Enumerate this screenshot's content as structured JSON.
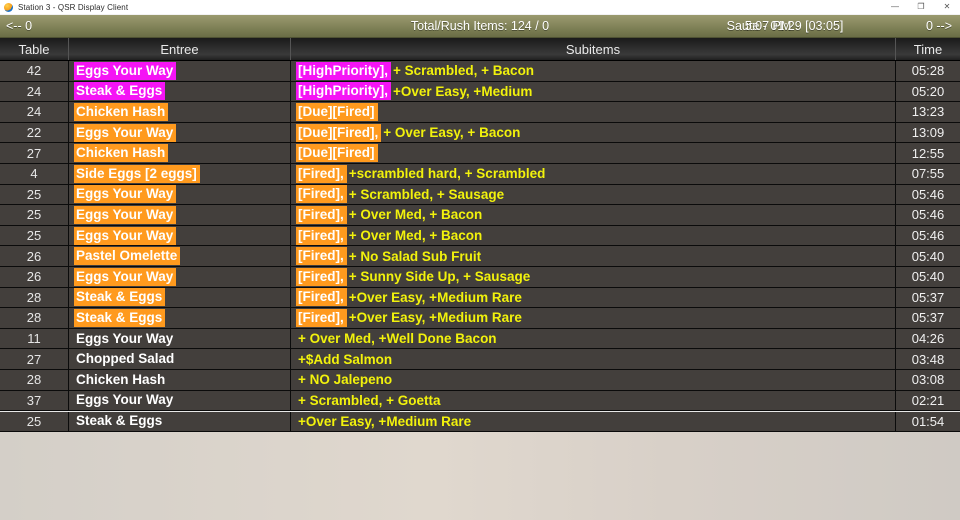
{
  "window": {
    "title": "Station 3 - QSR Display Client",
    "icon": "app-globe-icon",
    "controls": {
      "minimize": "—",
      "maximize": "❐",
      "close": "✕"
    }
  },
  "statusbar": {
    "left_nav": "<-- 0",
    "total_label": "Total/Rush Items: 124 / 0",
    "station": "Saute  - 01:29   [03:05]",
    "clock": "5:07 PM",
    "right_nav": "0 -->"
  },
  "colors": {
    "status_bar": "#8d8d63",
    "row_bg": "#43403d",
    "header_bg": "#2e2e2e",
    "high_priority": "#f514f5",
    "fired": "#ff9a1e",
    "subitem_text": "#f2f20c",
    "entree_text": "#ffffff"
  },
  "table": {
    "columns": [
      "Table",
      "Entree",
      "Subitems",
      "Time"
    ],
    "rows": [
      {
        "table": "42",
        "entree": "Eggs Your Way",
        "entree_hl": "magenta",
        "tag": "[HighPriority],",
        "tag_hl": "magenta",
        "subitems": "+ Scrambled, + Bacon",
        "time": "05:28"
      },
      {
        "table": "24",
        "entree": "Steak & Eggs",
        "entree_hl": "magenta",
        "tag": "[HighPriority],",
        "tag_hl": "magenta",
        "subitems": "+Over Easy, +Medium",
        "time": "05:20"
      },
      {
        "table": "24",
        "entree": "Chicken Hash",
        "entree_hl": "orange",
        "tag": "[Due][Fired]",
        "tag_hl": "orange",
        "subitems": "",
        "time": "13:23"
      },
      {
        "table": "22",
        "entree": "Eggs Your Way",
        "entree_hl": "orange",
        "tag": "[Due][Fired],",
        "tag_hl": "orange",
        "subitems": "+ Over Easy, + Bacon",
        "time": "13:09"
      },
      {
        "table": "27",
        "entree": "Chicken Hash",
        "entree_hl": "orange",
        "tag": "[Due][Fired]",
        "tag_hl": "orange",
        "subitems": "",
        "time": "12:55"
      },
      {
        "table": "4",
        "entree": "Side Eggs [2 eggs]",
        "entree_hl": "orange",
        "tag": "[Fired],",
        "tag_hl": "orange",
        "subitems": "+scrambled hard, + Scrambled",
        "time": "07:55"
      },
      {
        "table": "25",
        "entree": "Eggs Your Way",
        "entree_hl": "orange",
        "tag": "[Fired],",
        "tag_hl": "orange",
        "subitems": "+ Scrambled, + Sausage",
        "time": "05:46"
      },
      {
        "table": "25",
        "entree": "Eggs Your Way",
        "entree_hl": "orange",
        "tag": "[Fired],",
        "tag_hl": "orange",
        "subitems": "+ Over Med, + Bacon",
        "time": "05:46"
      },
      {
        "table": "25",
        "entree": "Eggs Your Way",
        "entree_hl": "orange",
        "tag": "[Fired],",
        "tag_hl": "orange",
        "subitems": "+ Over Med, + Bacon",
        "time": "05:46"
      },
      {
        "table": "26",
        "entree": "Pastel Omelette",
        "entree_hl": "orange",
        "tag": "[Fired],",
        "tag_hl": "orange",
        "subitems": "+ No Salad Sub Fruit",
        "time": "05:40"
      },
      {
        "table": "26",
        "entree": "Eggs Your Way",
        "entree_hl": "orange",
        "tag": "[Fired],",
        "tag_hl": "orange",
        "subitems": "+ Sunny Side Up, + Sausage",
        "time": "05:40"
      },
      {
        "table": "28",
        "entree": "Steak & Eggs",
        "entree_hl": "orange",
        "tag": "[Fired],",
        "tag_hl": "orange",
        "subitems": "+Over Easy, +Medium Rare",
        "time": "05:37"
      },
      {
        "table": "28",
        "entree": "Steak & Eggs",
        "entree_hl": "orange",
        "tag": "[Fired],",
        "tag_hl": "orange",
        "subitems": "+Over Easy, +Medium Rare",
        "time": "05:37"
      },
      {
        "table": "11",
        "entree": "Eggs Your Way",
        "entree_hl": "none",
        "tag": "",
        "tag_hl": "none",
        "subitems": "+ Over Med, +Well Done Bacon",
        "time": "04:26"
      },
      {
        "table": "27",
        "entree": "Chopped Salad",
        "entree_hl": "none",
        "tag": "",
        "tag_hl": "none",
        "subitems": "+$Add Salmon",
        "time": "03:48"
      },
      {
        "table": "28",
        "entree": "Chicken Hash",
        "entree_hl": "none",
        "tag": "",
        "tag_hl": "none",
        "subitems": "+ NO Jalepeno",
        "time": "03:08"
      },
      {
        "table": "37",
        "entree": "Eggs Your Way",
        "entree_hl": "none",
        "tag": "",
        "tag_hl": "none",
        "subitems": "+ Scrambled, + Goetta",
        "time": "02:21"
      },
      {
        "table": "25",
        "entree": "Steak & Eggs",
        "entree_hl": "none",
        "tag": "",
        "tag_hl": "none",
        "subitems": "+Over Easy, +Medium Rare",
        "time": "01:54",
        "selected": true
      }
    ]
  }
}
